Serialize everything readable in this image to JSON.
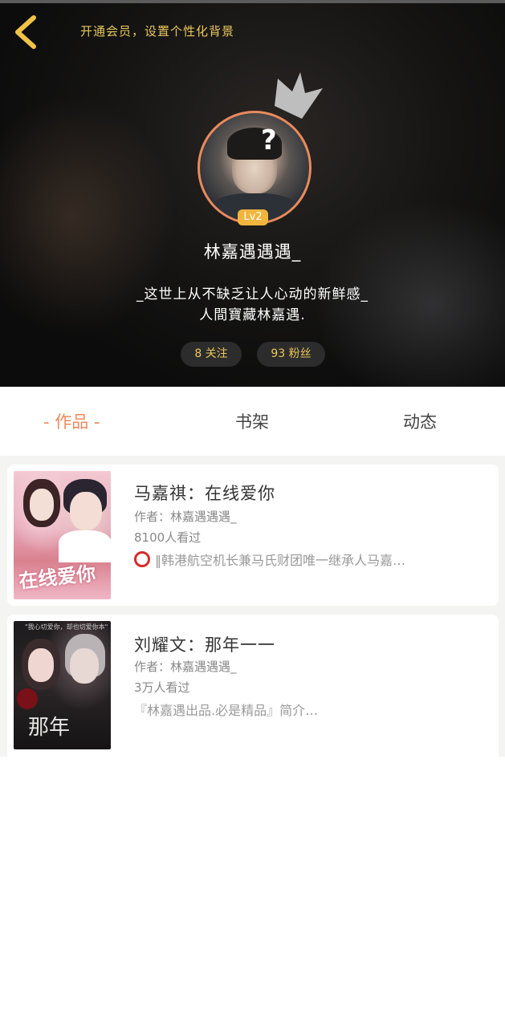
{
  "header": {
    "vip_text": "开通会员，设置个性化背景",
    "level": "Lv2",
    "username": "林嘉遇遇遇_",
    "bio_line1": "_这世上从不缺乏让人心动的新鲜感_",
    "bio_line2": "人間寶藏林嘉遇.",
    "following": "8 关注",
    "fans": "93 粉丝"
  },
  "tabs": {
    "works": "- 作品 -",
    "shelf": "书架",
    "feed": "动态"
  },
  "books": [
    {
      "cover_text": "在线爱你",
      "title": "马嘉祺：在线爱你",
      "author": "作者：林嘉遇遇遇_",
      "views": "8100人看过",
      "desc": "‖韩港航空机长兼马氏财团唯一继承人马嘉…"
    },
    {
      "cover_top": "\"我心切爱你，却也切爱你本\"",
      "cover_text": "那年",
      "title": "刘耀文：那年一一",
      "author": "作者：林嘉遇遇遇_",
      "views": "3万人看过",
      "desc": "『林嘉遇出品.必是精品』简介…"
    }
  ],
  "colors": {
    "accent": "#f08a5d",
    "gold": "#e9c75a",
    "level_badge": "#f1b53d",
    "avatar_ring": "#e98a5c"
  }
}
